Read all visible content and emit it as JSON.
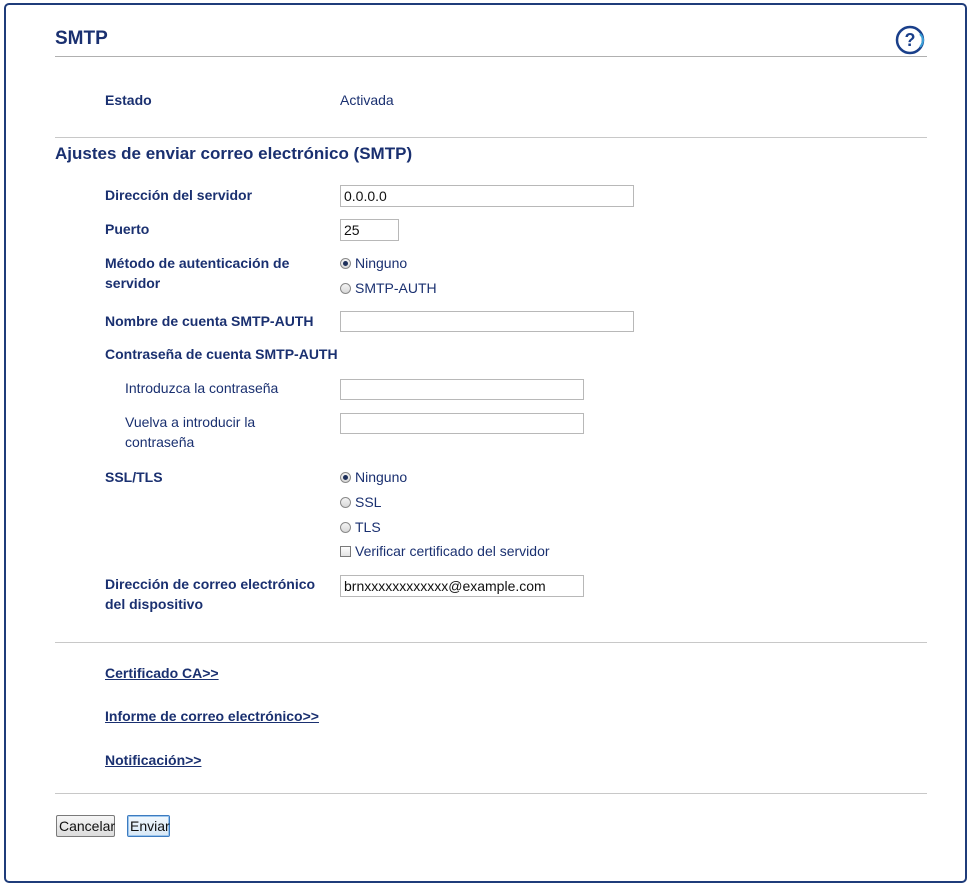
{
  "page": {
    "title": "SMTP",
    "help_icon": "question-circle-icon"
  },
  "status": {
    "label": "Estado",
    "value": "Activada"
  },
  "section": {
    "title": "Ajustes de enviar correo electrónico (SMTP)"
  },
  "server_address": {
    "label": "Dirección del servidor",
    "value": "0.0.0.0"
  },
  "port": {
    "label": "Puerto",
    "value": "25"
  },
  "auth_method": {
    "label_line1": "Método de autenticación de",
    "label_line2": "servidor",
    "options": [
      "Ninguno",
      "SMTP-AUTH"
    ],
    "selected": "Ninguno"
  },
  "account_name": {
    "label": "Nombre de cuenta SMTP-AUTH",
    "value": ""
  },
  "account_password": {
    "label": "Contraseña de cuenta SMTP-AUTH",
    "enter_label": "Introduzca la contraseña",
    "reenter_line1": "Vuelva a introducir la",
    "reenter_line2": "contraseña"
  },
  "ssl_tls": {
    "label": "SSL/TLS",
    "options": [
      "Ninguno",
      "SSL",
      "TLS"
    ],
    "selected": "Ninguno",
    "verify_label": "Verificar certificado del servidor",
    "verify_checked": false
  },
  "device_email": {
    "label_line1": "Dirección de correo electrónico",
    "label_line2": "del dispositivo",
    "value": "brnxxxxxxxxxxxx@example.com"
  },
  "links": {
    "ca_cert": "Certificado CA>>",
    "email_report": "Informe de correo electrónico>>",
    "notification": "Notificación>>"
  },
  "buttons": {
    "cancel": "Cancelar",
    "submit": "Enviar"
  },
  "colors": {
    "text": "#1a3070",
    "frame": "#1f3c7a"
  }
}
